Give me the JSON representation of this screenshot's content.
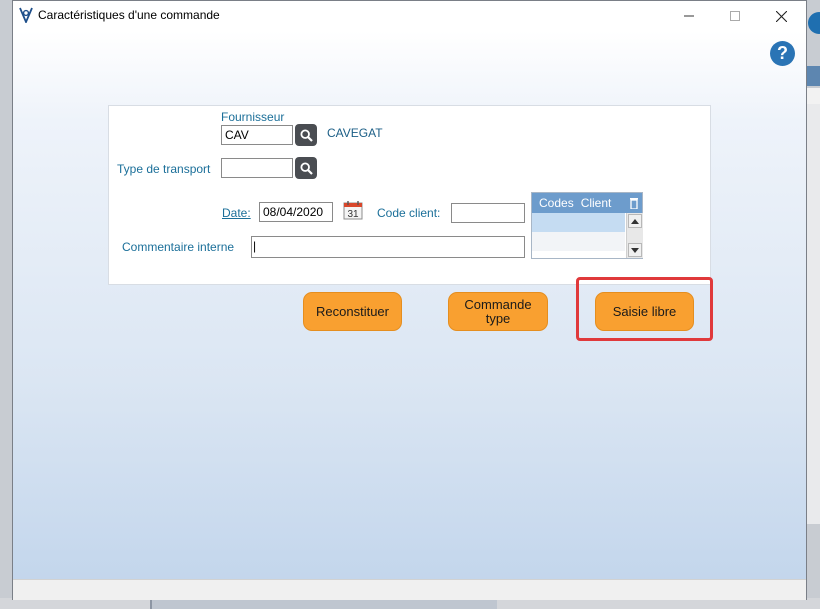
{
  "window": {
    "title": "Caractéristiques d'une commande",
    "help_label": "?"
  },
  "form": {
    "fournisseur_label": "Fournisseur",
    "fournisseur_value": "CAV",
    "fournisseur_name": "CAVEGAT",
    "transport_label": "Type de transport",
    "transport_value": "",
    "date_label": "Date:",
    "date_value": "08/04/2020",
    "calendar_day": "31",
    "code_client_label": "Code client:",
    "code_client_value": "",
    "commentaire_label": "Commentaire interne",
    "commentaire_value": "|"
  },
  "codes_table": {
    "headers": [
      "Codes",
      "Client"
    ]
  },
  "buttons": {
    "reconstituer": "Reconstituer",
    "commande_type_line1": "Commande",
    "commande_type_line2": "type",
    "saisie_libre": "Saisie libre"
  },
  "colors": {
    "accent_orange": "#f9a030",
    "label_blue": "#1b6f99",
    "highlight_red": "#e0393b"
  },
  "icons": {
    "app": "app-logo-icon",
    "search": "magnifier-icon",
    "calendar": "calendar-icon",
    "trash": "trash-icon",
    "help": "help-icon"
  }
}
